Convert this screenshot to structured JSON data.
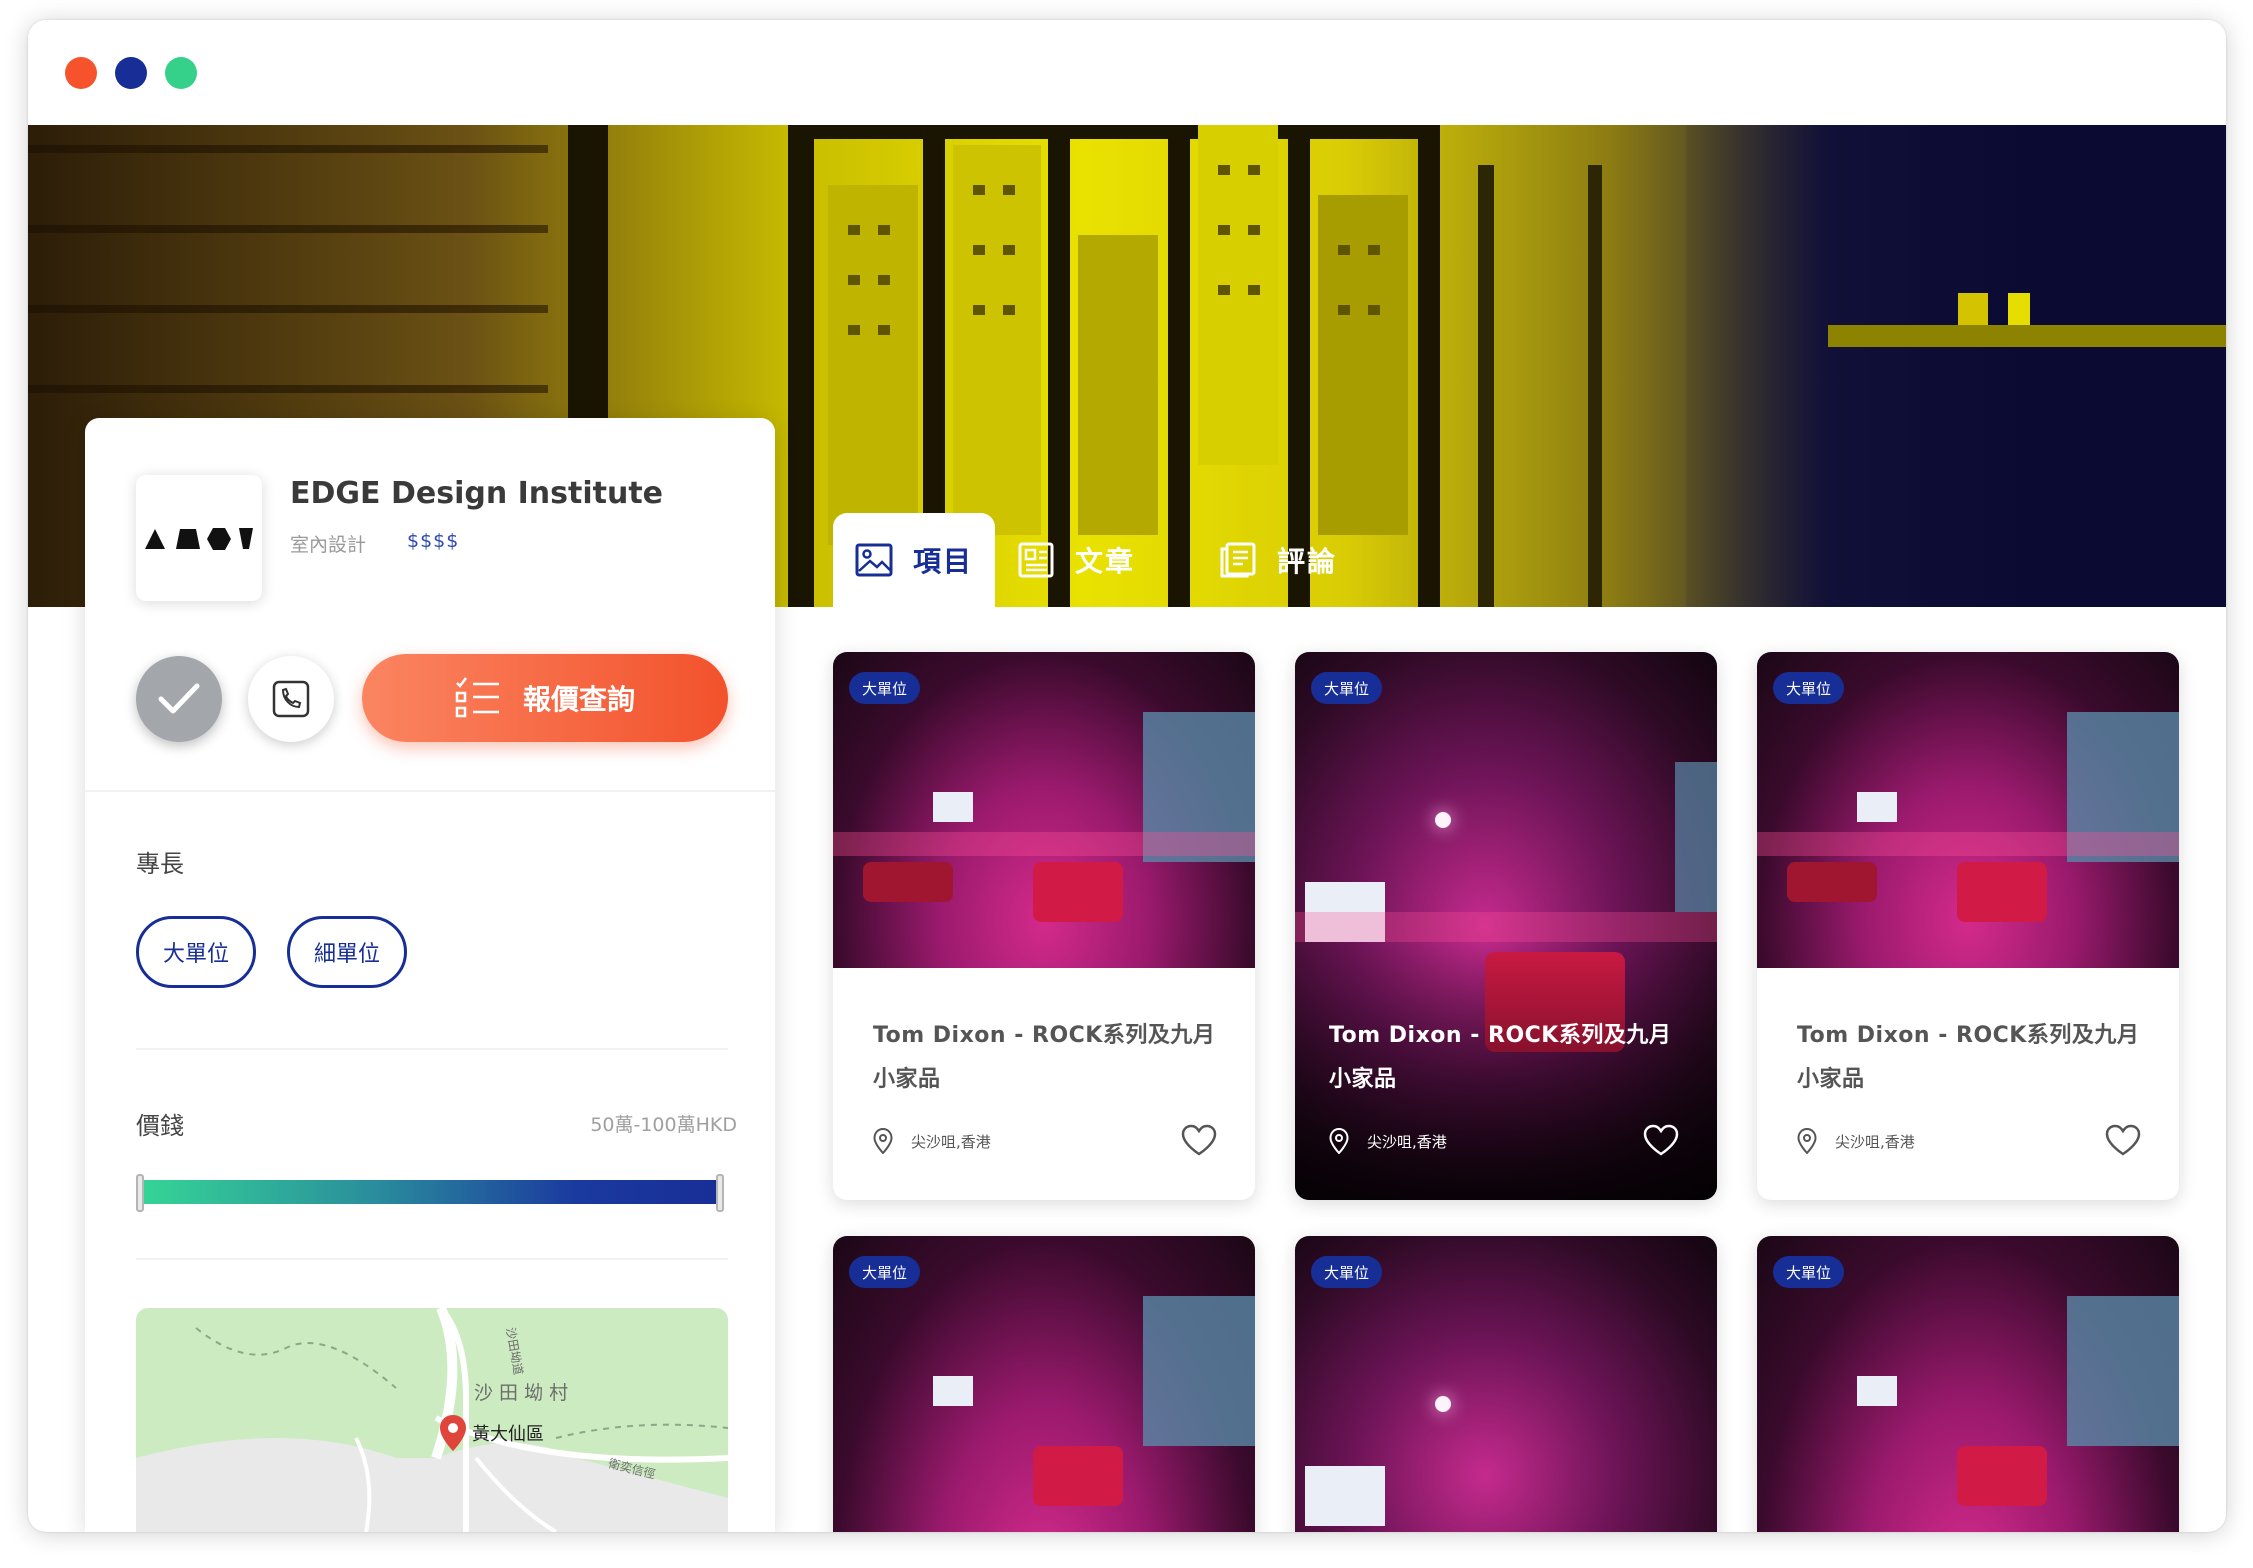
{
  "window": {
    "controls": [
      "close",
      "minimize",
      "maximize"
    ]
  },
  "tabs": [
    {
      "label": "項目",
      "icon": "image-icon",
      "active": true
    },
    {
      "label": "文章",
      "icon": "article-icon",
      "active": false
    },
    {
      "label": "評論",
      "icon": "review-icon",
      "active": false
    }
  ],
  "company": {
    "name": "EDGE Design Institute",
    "category": "室內設計",
    "price_level": "$$$$"
  },
  "actions": {
    "quote_label": "報價查詢"
  },
  "specialties": {
    "title": "專長",
    "items": [
      "大單位",
      "細單位"
    ]
  },
  "price": {
    "title": "價錢",
    "range_text": "50萬-100萬HKD",
    "range": [
      0,
      1
    ]
  },
  "map": {
    "village": "沙 田 坳 村",
    "district": "黃大仙區",
    "road1": "沙田坳道",
    "road2": "衛奕信徑"
  },
  "cards": [
    {
      "badge": "大單位",
      "title": "Tom Dixon - ROCK系列及九月小家品",
      "location": "尖沙咀,香港"
    },
    {
      "badge": "大單位",
      "title": "Tom Dixon - ROCK系列及九月小家品",
      "location": "尖沙咀,香港"
    },
    {
      "badge": "大單位",
      "title": "Tom Dixon - ROCK系列及九月小家品",
      "location": "尖沙咀,香港"
    },
    {
      "badge": "大單位"
    },
    {
      "badge": "大單位"
    },
    {
      "badge": "大單位"
    }
  ],
  "colors": {
    "primary": "#172e96",
    "accent": "#f2522c",
    "window_red": "#f6532d",
    "window_green": "#35d18b"
  }
}
